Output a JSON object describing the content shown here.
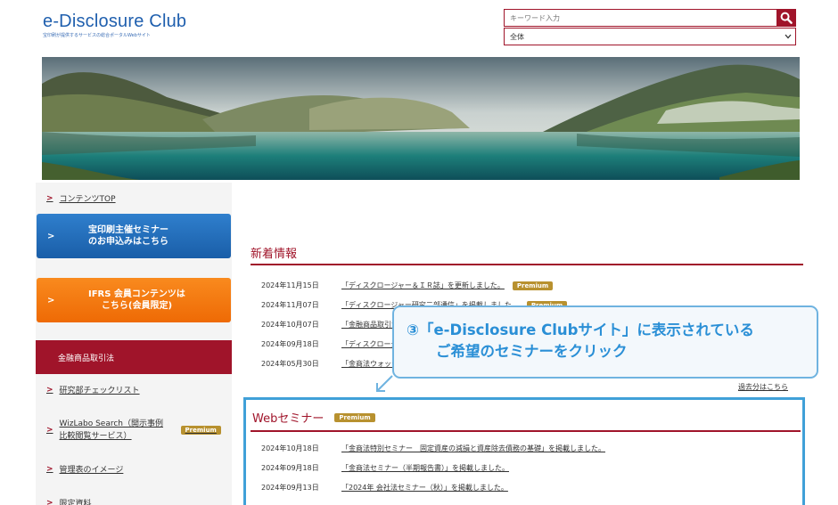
{
  "header": {
    "logo_title": "e-Disclosure Club",
    "logo_subtitle": "宝印刷が提供するサービスの総合ポータルWebサイト",
    "search_placeholder": "キーワード入力",
    "search_scope": "全体"
  },
  "sidebar": {
    "top_link": "コンテンツTOP",
    "seminar_button": [
      "宝印刷主催セミナー",
      "のお申込みはこちら"
    ],
    "ifrs_button": [
      "IFRS 会員コンテンツは",
      "こちら(会員限定)"
    ],
    "category_header": "金融商品取引法",
    "items": [
      {
        "label": "研究部チェックリスト"
      },
      {
        "label_line1": "WizLabo Search（開示事例",
        "label_line2": "比較閲覧サービス）",
        "badge": "Premium"
      },
      {
        "label": "管理表のイメージ"
      },
      {
        "label": "限定資料"
      }
    ]
  },
  "news": {
    "title": "新着情報",
    "items": [
      {
        "date": "2024年11月15日",
        "text": "「ディスクロージャー＆ＩＲ誌」を更新しました。",
        "badge": "Premium"
      },
      {
        "date": "2024年11月07日",
        "text": "「ディスクロージャー研究二部通信」を掲載しました。",
        "badge": "Premium"
      },
      {
        "date": "2024年10月07日",
        "text": "「金融商品取引法"
      },
      {
        "date": "2024年09月18日",
        "text": "「ディスクロージャー"
      },
      {
        "date": "2024年05月30日",
        "text": "「金商法ウォッチ"
      }
    ],
    "past_link": "過去分はこちら"
  },
  "web_seminar": {
    "title": "Webセミナー",
    "badge": "Premium",
    "items": [
      {
        "date": "2024年10月18日",
        "text": "「金商法特別セミナー　固定資産の減損と資産除去債務の基礎」を掲載しました。"
      },
      {
        "date": "2024年09月18日",
        "text": "「金商法セミナー（半期報告書）」を掲載しました。"
      },
      {
        "date": "2024年09月13日",
        "text": "「2024年 会社法セミナー（秋）」を掲載しました。"
      }
    ]
  },
  "callout": {
    "line1": "③「e-Disclosure Clubサイト」に表示されている",
    "line2": "ご希望のセミナーをクリック"
  },
  "colors": {
    "brand_red": "#a0142a",
    "logo_blue": "#1f5fae",
    "premium_gold": "#b8912f",
    "highlight_blue": "#40a0d8",
    "seminar_button_blue": "#1a5ea8",
    "ifrs_button_orange": "#ee6a05"
  }
}
